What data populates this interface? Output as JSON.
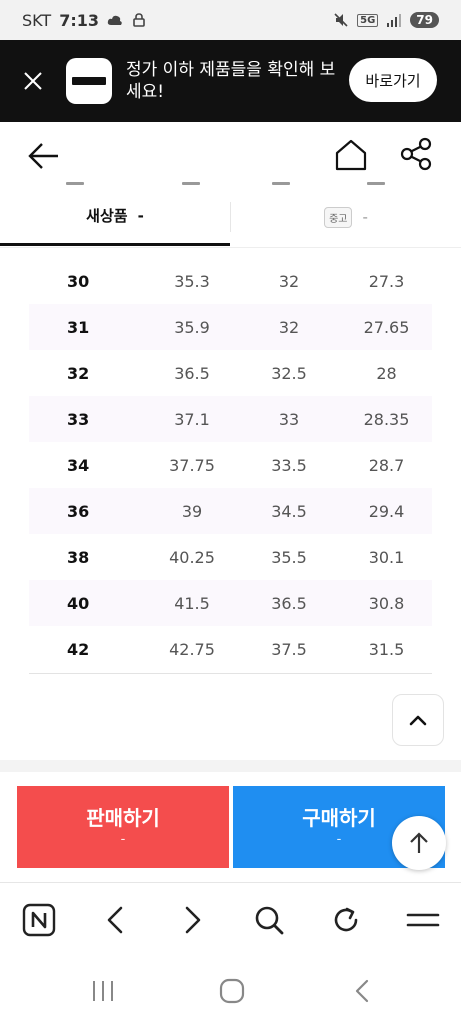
{
  "status_bar": {
    "carrier": "SKT",
    "time": "7:13",
    "network": "5G",
    "battery": "79"
  },
  "banner": {
    "message": "정가 이하 제품들을 확인해 보세요!",
    "button_label": "바로가기"
  },
  "tabs": [
    {
      "label": "새상품",
      "value": "-",
      "active": true
    },
    {
      "chip": "중고",
      "value": "-",
      "active": false
    }
  ],
  "size_table": {
    "rows": [
      [
        "30",
        "35.3",
        "32",
        "27.3"
      ],
      [
        "31",
        "35.9",
        "32",
        "27.65"
      ],
      [
        "32",
        "36.5",
        "32.5",
        "28"
      ],
      [
        "33",
        "37.1",
        "33",
        "28.35"
      ],
      [
        "34",
        "37.75",
        "33.5",
        "28.7"
      ],
      [
        "36",
        "39",
        "34.5",
        "29.4"
      ],
      [
        "38",
        "40.25",
        "35.5",
        "30.1"
      ],
      [
        "40",
        "41.5",
        "36.5",
        "30.8"
      ],
      [
        "42",
        "42.75",
        "37.5",
        "31.5"
      ]
    ]
  },
  "actions": {
    "sell_label": "판매하기",
    "sell_price": "-",
    "buy_label": "구매하기",
    "buy_price": "-"
  },
  "colors": {
    "sell": "#f44d4d",
    "buy": "#1f8ef1",
    "banner_bg": "#111111"
  }
}
